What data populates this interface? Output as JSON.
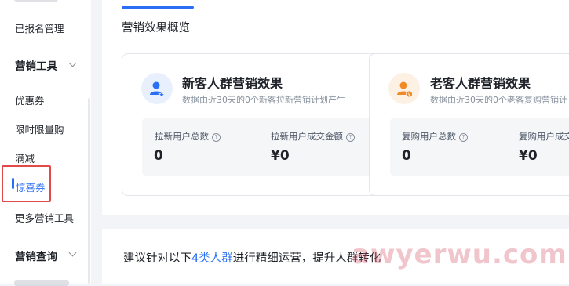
{
  "sidebar": {
    "items": [
      {
        "label": "已报名管理"
      },
      {
        "label": "营销工具",
        "group": true
      },
      {
        "label": "优惠券"
      },
      {
        "label": "限时限量购"
      },
      {
        "label": "满减"
      },
      {
        "label": "惊喜券",
        "active": true
      },
      {
        "label": "更多营销工具"
      },
      {
        "label": "营销查询",
        "group": true
      }
    ]
  },
  "main": {
    "section_title": "营销效果概览",
    "cards": [
      {
        "title": "新客人群营销效果",
        "subtitle": "数据由近30天的0个新客拉新营销计划产生",
        "icon": "user-star-icon",
        "stats": [
          {
            "label": "拉新用户总数",
            "value": "0"
          },
          {
            "label": "拉新用户成交金额",
            "value": "¥0"
          }
        ]
      },
      {
        "title": "老客人群营销效果",
        "subtitle": "数据由近30天的0个老客复购营销计",
        "icon": "user-yuan-icon",
        "stats": [
          {
            "label": "复购用户总数",
            "value": "0"
          },
          {
            "label": "复购用户成交",
            "value": "¥0"
          }
        ]
      }
    ],
    "suggestion": {
      "prefix": "建议针对以下",
      "link": "4类人群",
      "suffix": "进行精细运营，提升人群转化"
    }
  },
  "watermark": "awyerwu.com",
  "colors": {
    "accent": "#2a6ef5",
    "highlight": "#e24a4a",
    "orange": "#f08a24"
  }
}
